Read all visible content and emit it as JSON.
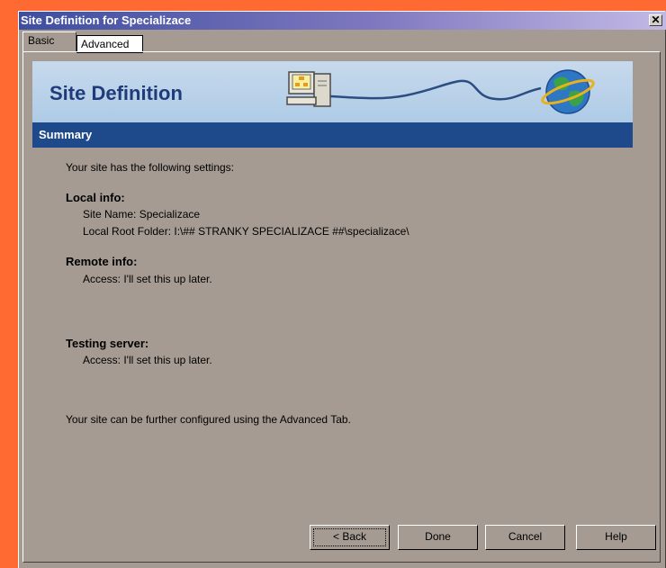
{
  "window": {
    "title": "Site Definition for Specializace",
    "close_symbol": "✕"
  },
  "tabs": [
    {
      "label": "Basic",
      "active": true
    },
    {
      "label": "Advanced",
      "active": false
    }
  ],
  "banner": {
    "title": "Site Definition",
    "art_icons": [
      "computer-icon",
      "globe-icon"
    ]
  },
  "section": {
    "header": "Summary",
    "intro": "Your site has the following settings:",
    "local": {
      "heading": "Local info:",
      "site_name": "Site Name: Specializace",
      "root_folder": "Local Root Folder: I:\\## STRANKY SPECIALIZACE ##\\specializace\\"
    },
    "remote": {
      "heading": "Remote info:",
      "access": "Access: I'll set this up later."
    },
    "testing": {
      "heading": "Testing server:",
      "access": "Access: I'll set this up later."
    },
    "footer_note": "Your site can be further configured using the Advanced Tab."
  },
  "buttons": {
    "back": "< Back",
    "done": "Done",
    "cancel": "Cancel",
    "help": "Help"
  },
  "colors": {
    "dialog_bg": "#a59b93",
    "summary_bar": "#1e4a8b",
    "banner_title": "#1f3b7a"
  }
}
